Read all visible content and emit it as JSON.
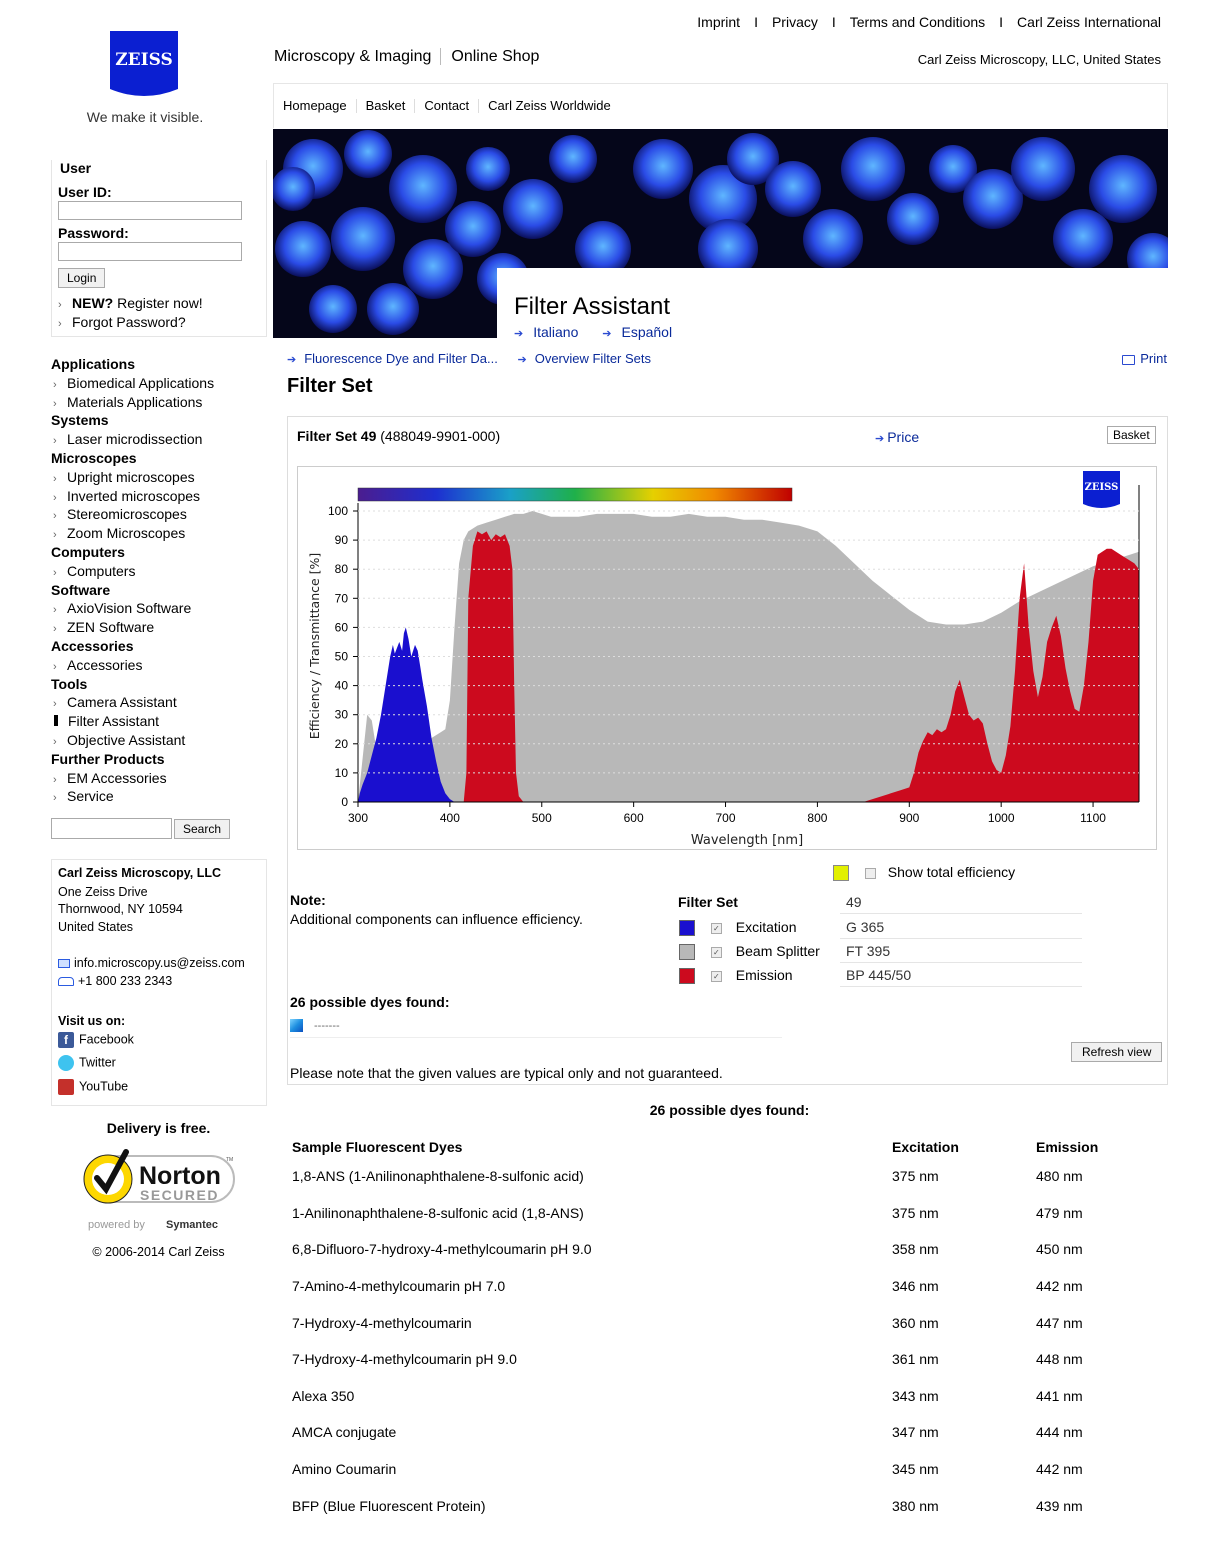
{
  "brand": {
    "logo_text": "ZEISS",
    "tagline": "We make it visible."
  },
  "top_links": [
    "Imprint",
    "Privacy",
    "Terms and Conditions",
    "Carl Zeiss International"
  ],
  "top_separator": "I",
  "brand_nav": {
    "section": "Microscopy & Imaging",
    "shop": "Online Shop"
  },
  "country": "Carl Zeiss Microscopy, LLC, United States",
  "sub_nav": [
    "Homepage",
    "Basket",
    "Contact",
    "Carl Zeiss Worldwide"
  ],
  "page_header": {
    "title": "Filter Assistant",
    "langs": [
      "Italiano",
      "Español"
    ]
  },
  "user_box": {
    "heading": "User",
    "user_id_label": "User ID:",
    "password_label": "Password:",
    "login": "Login",
    "new_bold": "NEW?",
    "register": " Register now!",
    "forgot": "Forgot Password?"
  },
  "menu": [
    {
      "type": "h",
      "label": "Applications"
    },
    {
      "type": "i",
      "label": "Biomedical Applications"
    },
    {
      "type": "i",
      "label": "Materials Applications"
    },
    {
      "type": "h",
      "label": "Systems"
    },
    {
      "type": "i",
      "label": "Laser microdissection"
    },
    {
      "type": "h",
      "label": "Microscopes"
    },
    {
      "type": "i",
      "label": "Upright microscopes"
    },
    {
      "type": "i",
      "label": "Inverted microscopes"
    },
    {
      "type": "i",
      "label": "Stereomicroscopes"
    },
    {
      "type": "i",
      "label": "Zoom Microscopes"
    },
    {
      "type": "h",
      "label": "Computers"
    },
    {
      "type": "i",
      "label": "Computers"
    },
    {
      "type": "h",
      "label": "Software"
    },
    {
      "type": "i",
      "label": "AxioVision Software"
    },
    {
      "type": "i",
      "label": "ZEN Software"
    },
    {
      "type": "h",
      "label": "Accessories"
    },
    {
      "type": "i",
      "label": "Accessories"
    },
    {
      "type": "h",
      "label": "Tools"
    },
    {
      "type": "i",
      "label": "Camera Assistant"
    },
    {
      "type": "a",
      "label": "Filter Assistant"
    },
    {
      "type": "i",
      "label": "Objective Assistant"
    },
    {
      "type": "h",
      "label": "Further Products"
    },
    {
      "type": "i",
      "label": "EM Accessories"
    },
    {
      "type": "i",
      "label": "Service"
    }
  ],
  "search": {
    "value": "",
    "button": "Search"
  },
  "contact": {
    "company": "Carl Zeiss Microscopy, LLC",
    "address1": "One Zeiss Drive",
    "address2": "Thornwood, NY 10594",
    "country": "United States",
    "email": "info.microscopy.us@zeiss.com",
    "phone": "+1 800 233 2343",
    "visit": "Visit us on:",
    "social": [
      "Facebook",
      "Twitter",
      "YouTube"
    ]
  },
  "delivery": "Delivery is free.",
  "norton": {
    "name": "Norton",
    "secured": "SECURED",
    "powered": "powered by",
    "symantec": "Symantec",
    "tm": "TM"
  },
  "copyright": "© 2006-2014 Carl Zeiss",
  "breadcrumbs": [
    "Fluorescence Dye and Filter Da...",
    "Overview Filter Sets"
  ],
  "print": "Print",
  "filter_heading": "Filter Set",
  "filter_set": {
    "name": "Filter Set 49",
    "code": " (488049-9901-000)",
    "price": "Price",
    "basket": "Basket"
  },
  "show_total": "Show total efficiency",
  "note": {
    "heading": "Note:",
    "text": "Additional components can influence efficiency."
  },
  "filter_list": {
    "heading": "Filter Set",
    "set_value": "49",
    "rows": [
      {
        "name": "Excitation",
        "value": "G 365",
        "color": "#1a0fcf"
      },
      {
        "name": "Beam Splitter",
        "value": "FT 395",
        "color": "#b8b8b8"
      },
      {
        "name": "Emission",
        "value": "BP 445/50",
        "color": "#cc0a1e"
      }
    ]
  },
  "dyes_found": "26 possible dyes found:",
  "dye_select_value": "-------",
  "refresh": "Refresh view",
  "disclaimer": "Please note that the given values are typical only and not guaranteed.",
  "dye_table": {
    "headers": [
      "Sample Fluorescent Dyes",
      "Excitation",
      "Emission"
    ],
    "rows": [
      [
        "1,8-ANS (1-Anilinonaphthalene-8-sulfonic acid)",
        "375 nm",
        "480 nm"
      ],
      [
        "1-Anilinonaphthalene-8-sulfonic acid (1,8-ANS)",
        "375 nm",
        "479 nm"
      ],
      [
        "6,8-Difluoro-7-hydroxy-4-methylcoumarin pH 9.0",
        "358 nm",
        "450 nm"
      ],
      [
        "7-Amino-4-methylcoumarin pH 7.0",
        "346 nm",
        "442 nm"
      ],
      [
        "7-Hydroxy-4-methylcoumarin",
        "360 nm",
        "447 nm"
      ],
      [
        "7-Hydroxy-4-methylcoumarin pH 9.0",
        "361 nm",
        "448 nm"
      ],
      [
        "Alexa 350",
        "343 nm",
        "441 nm"
      ],
      [
        "AMCA conjugate",
        "347 nm",
        "444 nm"
      ],
      [
        "Amino Coumarin",
        "345 nm",
        "442 nm"
      ],
      [
        "BFP (Blue Fluorescent Protein)",
        "380 nm",
        "439 nm"
      ]
    ]
  },
  "chart_data": {
    "type": "area",
    "xlabel": "Wavelength [nm]",
    "ylabel": "Efficiency / Transmittance [%]",
    "xlim": [
      300,
      1150
    ],
    "ylim": [
      0,
      100
    ],
    "xticks": [
      300,
      400,
      500,
      600,
      700,
      800,
      900,
      1000,
      1100
    ],
    "yticks": [
      0,
      10,
      20,
      30,
      40,
      50,
      60,
      70,
      80,
      90,
      100
    ],
    "grid": true,
    "logo_text": "ZEISS",
    "series": [
      {
        "name": "Beam Splitter",
        "color": "#b8b8b8",
        "x": [
          300,
          305,
          310,
          315,
          320,
          330,
          340,
          350,
          360,
          370,
          380,
          390,
          395,
          400,
          405,
          410,
          415,
          420,
          430,
          440,
          450,
          460,
          470,
          480,
          490,
          500,
          510,
          520,
          540,
          560,
          580,
          600,
          620,
          640,
          660,
          680,
          700,
          720,
          740,
          760,
          780,
          800,
          820,
          840,
          860,
          880,
          900,
          920,
          940,
          960,
          980,
          1000,
          1020,
          1040,
          1060,
          1080,
          1100,
          1120,
          1140,
          1150
        ],
        "y": [
          0,
          15,
          30,
          28,
          18,
          15,
          14,
          16,
          18,
          20,
          22,
          24,
          25,
          35,
          60,
          82,
          90,
          93,
          95,
          96,
          97,
          98,
          99,
          99,
          100,
          99,
          98,
          98,
          98,
          99,
          99,
          99,
          98,
          98,
          99,
          98,
          98,
          97,
          97,
          96,
          95,
          93,
          88,
          82,
          76,
          71,
          66,
          62,
          61,
          61,
          62,
          65,
          69,
          72,
          75,
          78,
          81,
          83,
          85,
          86
        ]
      },
      {
        "name": "Excitation",
        "color": "#1a0fcf",
        "x": [
          300,
          302,
          305,
          310,
          315,
          320,
          325,
          330,
          335,
          338,
          340,
          345,
          348,
          350,
          352,
          355,
          358,
          360,
          362,
          365,
          368,
          370,
          375,
          380,
          385,
          390,
          395,
          400,
          405,
          410
        ],
        "y": [
          0,
          3,
          6,
          10,
          16,
          22,
          30,
          40,
          50,
          54,
          51,
          55,
          52,
          58,
          60,
          56,
          50,
          52,
          54,
          52,
          46,
          42,
          33,
          22,
          14,
          7,
          3,
          1,
          0,
          0
        ]
      },
      {
        "name": "Emission",
        "color": "#cc0a1e",
        "x": [
          300,
          410,
          415,
          418,
          420,
          425,
          430,
          435,
          440,
          445,
          450,
          455,
          460,
          465,
          468,
          470,
          472,
          475,
          480,
          850,
          860,
          870,
          880,
          890,
          900,
          905,
          910,
          915,
          920,
          925,
          930,
          935,
          940,
          945,
          950,
          955,
          960,
          965,
          970,
          975,
          980,
          985,
          990,
          995,
          1000,
          1005,
          1010,
          1015,
          1020,
          1025,
          1030,
          1035,
          1040,
          1045,
          1050,
          1055,
          1060,
          1065,
          1070,
          1075,
          1080,
          1085,
          1090,
          1095,
          1100,
          1105,
          1110,
          1115,
          1120,
          1125,
          1130,
          1135,
          1140,
          1145,
          1150
        ],
        "y": [
          0,
          0,
          0,
          10,
          70,
          88,
          93,
          92,
          93,
          90,
          92,
          91,
          92,
          88,
          80,
          40,
          10,
          2,
          0,
          0,
          1,
          2,
          3,
          4,
          5,
          10,
          17,
          21,
          24,
          23,
          25,
          24,
          25,
          30,
          38,
          42,
          36,
          30,
          28,
          29,
          27,
          20,
          14,
          11,
          10,
          16,
          26,
          45,
          70,
          82,
          60,
          45,
          36,
          43,
          55,
          60,
          64,
          57,
          46,
          38,
          32,
          31,
          40,
          55,
          76,
          85,
          86,
          87,
          87,
          86,
          85,
          84,
          83,
          82,
          80
        ]
      }
    ]
  }
}
